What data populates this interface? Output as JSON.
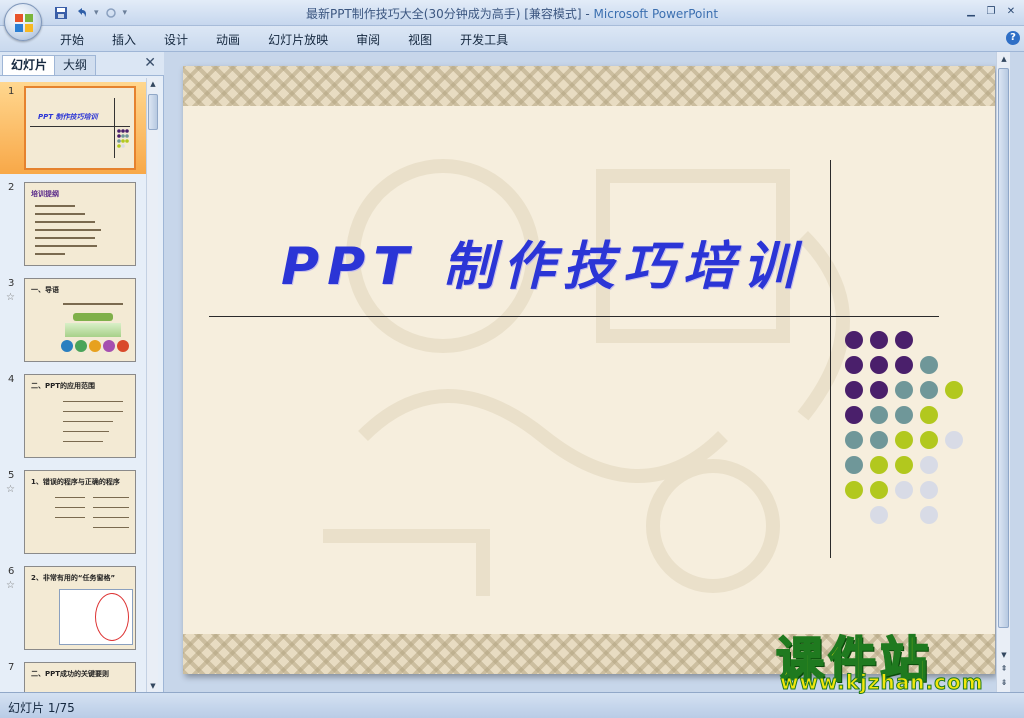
{
  "window": {
    "title": "最新PPT制作技巧大全(30分钟成为高手) [兼容模式] - ",
    "app_name": "Microsoft PowerPoint"
  },
  "ribbon": {
    "tabs": [
      "开始",
      "插入",
      "设计",
      "动画",
      "幻灯片放映",
      "审阅",
      "视图",
      "开发工具"
    ]
  },
  "left_panel": {
    "tabs": [
      "幻灯片",
      "大纲"
    ],
    "thumbnails": [
      {
        "num": "1",
        "title": "PPT 制作技巧培训",
        "star": ""
      },
      {
        "num": "2",
        "title": "培训提纲",
        "star": ""
      },
      {
        "num": "3",
        "title": "一、导语",
        "star": "☆"
      },
      {
        "num": "4",
        "title": "二、PPT的应用范围",
        "star": ""
      },
      {
        "num": "5",
        "title": "1、错误的程序与正确的程序",
        "star": "☆"
      },
      {
        "num": "6",
        "title": "2、非常有用的“任务窗格”",
        "star": "☆"
      },
      {
        "num": "7",
        "title": "二、PPT成功的关键要则",
        "star": ""
      }
    ]
  },
  "slide": {
    "title": "PPT 制作技巧培训",
    "dot_colors": {
      "purple": "#4a1f6b",
      "teal": "#6f9799",
      "lime": "#b2c81e",
      "pale": "#d8dbe6"
    }
  },
  "status": {
    "slide_indicator": "幻灯片 1/75"
  },
  "brand": {
    "name": "课件站",
    "url": "www.kjzhan.com"
  }
}
